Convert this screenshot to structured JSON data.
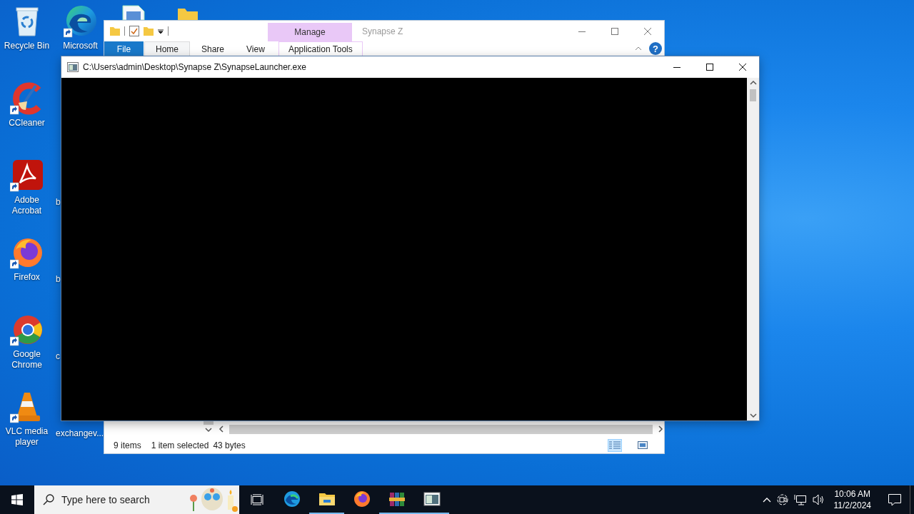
{
  "desktop": {
    "columns": [
      [
        {
          "kind": "recycle",
          "label": "Recycle Bin"
        },
        {
          "kind": "ccleaner",
          "label": "CCleaner"
        },
        {
          "kind": "acrobat",
          "label": "Adobe Acrobat"
        },
        {
          "kind": "firefox",
          "label": "Firefox"
        },
        {
          "kind": "chrome",
          "label": "Google Chrome"
        },
        {
          "kind": "vlc",
          "label": "VLC media player"
        }
      ],
      [
        {
          "kind": "edge",
          "label": "Microsoft"
        },
        {
          "kind": "covered"
        },
        {
          "kind": "covered",
          "label": "b"
        },
        {
          "kind": "covered",
          "label": "b"
        },
        {
          "kind": "covered",
          "label": "c"
        },
        {
          "kind": "covered",
          "label": "exchangev..."
        }
      ],
      [
        {
          "kind": "document"
        }
      ],
      [
        {
          "kind": "folder"
        }
      ]
    ]
  },
  "explorer": {
    "title": "Synapse Z",
    "tab_group": "Manage",
    "tabs": [
      {
        "label": "File",
        "kind": "file",
        "selected": false
      },
      {
        "label": "Home",
        "kind": "tab",
        "selected": true
      },
      {
        "label": "Share",
        "kind": "tab",
        "selected": false
      },
      {
        "label": "View",
        "kind": "tab",
        "selected": false
      },
      {
        "label": "Application Tools",
        "kind": "contextual",
        "selected": false
      }
    ],
    "help": "?",
    "status": {
      "items": "9 items",
      "selection": "1 item selected",
      "size": "43 bytes"
    }
  },
  "console": {
    "title": "C:\\Users\\admin\\Desktop\\Synapse Z\\SynapseLauncher.exe"
  },
  "taskbar": {
    "search": {
      "placeholder": "Type here to search"
    },
    "apps": [
      {
        "kind": "edge",
        "running": false
      },
      {
        "kind": "explorer",
        "running": true
      },
      {
        "kind": "firefox",
        "running": false
      },
      {
        "kind": "winrar",
        "running": true
      },
      {
        "kind": "console",
        "running": true
      }
    ],
    "clock": {
      "time": "10:06 AM",
      "date": "11/2/2024"
    }
  }
}
